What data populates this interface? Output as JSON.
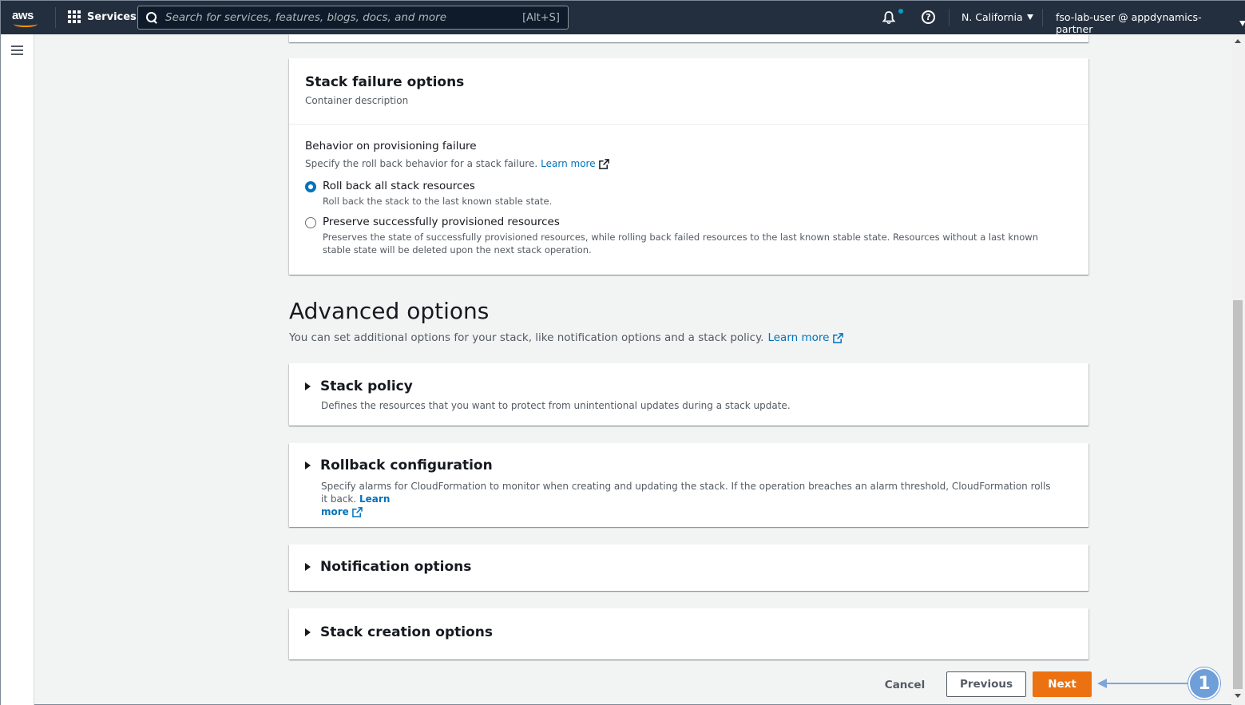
{
  "topnav": {
    "logo": "aws",
    "services_label": "Services",
    "search_placeholder": "Search for services, features, blogs, docs, and more",
    "search_shortcut": "[Alt+S]",
    "region": "N. California",
    "user": "fso-lab-user @ appdynamics-partner"
  },
  "stack_failure": {
    "title": "Stack failure options",
    "description": "Container description",
    "behavior_label": "Behavior on provisioning failure",
    "behavior_help": "Specify the roll back behavior for a stack failure.",
    "learn_more": "Learn more",
    "options": [
      {
        "title": "Roll back all stack resources",
        "description": "Roll back the stack to the last known stable state.",
        "selected": true
      },
      {
        "title": "Preserve successfully provisioned resources",
        "description": "Preserves the state of successfully provisioned resources, while rolling back failed resources to the last known stable state. Resources without a last known stable state will be deleted upon the next stack operation.",
        "selected": false
      }
    ]
  },
  "advanced": {
    "title": "Advanced options",
    "description": "You can set additional options for your stack, like notification options and a stack policy.",
    "learn_more": "Learn more",
    "sections": {
      "policy": {
        "title": "Stack policy",
        "description": "Defines the resources that you want to protect from unintentional updates during a stack update."
      },
      "rollback": {
        "title": "Rollback configuration",
        "description": "Specify alarms for CloudFormation to monitor when creating and updating the stack. If the operation breaches an alarm threshold, CloudFormation rolls it back.",
        "learn": "Learn",
        "more": "more"
      },
      "notification": {
        "title": "Notification options"
      },
      "creation": {
        "title": "Stack creation options"
      }
    }
  },
  "footer": {
    "cancel": "Cancel",
    "previous": "Previous",
    "next": "Next"
  },
  "annotation": {
    "step": "1"
  },
  "colors": {
    "nav_bg": "#232f3e",
    "link": "#0073bb",
    "primary_button": "#ec7211",
    "annotation": "#6f9fd8"
  }
}
